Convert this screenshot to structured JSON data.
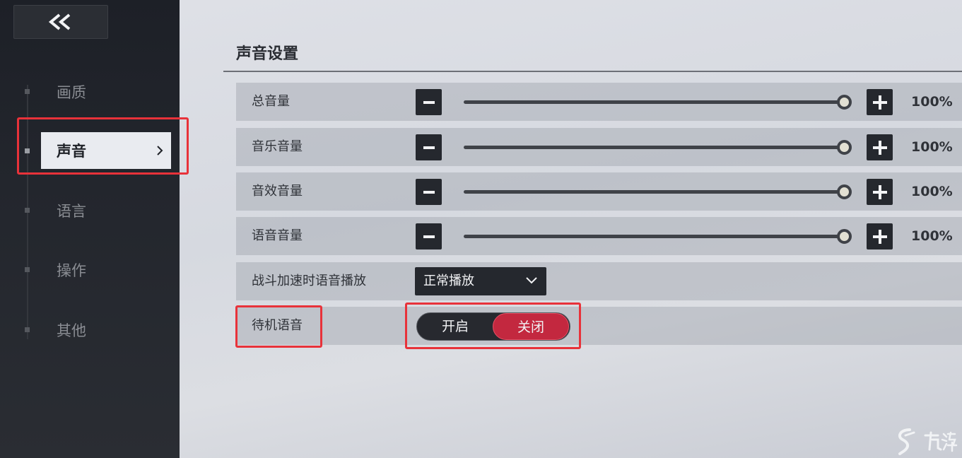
{
  "sidebar": {
    "back_icon": "double-chevron-left-icon",
    "items": [
      {
        "label": "画质"
      },
      {
        "label": "声音"
      },
      {
        "label": "语言"
      },
      {
        "label": "操作"
      },
      {
        "label": "其他"
      }
    ],
    "active_index": 1
  },
  "main": {
    "title": "声音设置",
    "volume_rows": [
      {
        "label": "总音量",
        "value": "100%",
        "level": 1.0
      },
      {
        "label": "音乐音量",
        "value": "100%",
        "level": 1.0
      },
      {
        "label": "音效音量",
        "value": "100%",
        "level": 1.0
      },
      {
        "label": "语音音量",
        "value": "100%",
        "level": 1.0
      }
    ],
    "battle_voice": {
      "label": "战斗加速时语音播放",
      "selected": "正常播放"
    },
    "idle_voice": {
      "label": "待机语音",
      "on_label": "开启",
      "off_label": "关闭",
      "state": "off"
    }
  },
  "colors": {
    "accent": "#c3283f",
    "highlight_box": "#e8323a"
  }
}
